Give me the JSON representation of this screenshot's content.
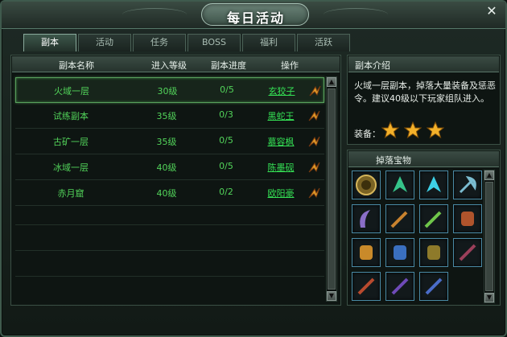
{
  "window": {
    "title": "每日活动"
  },
  "tabs": [
    {
      "label": "副本",
      "active": true
    },
    {
      "label": "活动",
      "active": false
    },
    {
      "label": "任务",
      "active": false
    },
    {
      "label": "BOSS",
      "active": false
    },
    {
      "label": "福利",
      "active": false
    },
    {
      "label": "活跃",
      "active": false
    }
  ],
  "table": {
    "headers": [
      "副本名称",
      "进入等级",
      "副本进度",
      "操作"
    ],
    "rows": [
      {
        "name": "火域一层",
        "level": "30级",
        "progress": "0/5",
        "npc": "玄狡子",
        "selected": true
      },
      {
        "name": "试练副本",
        "level": "35级",
        "progress": "0/3",
        "npc": "黑蛇王",
        "selected": false
      },
      {
        "name": "古矿一层",
        "level": "35级",
        "progress": "0/5",
        "npc": "慕容枫",
        "selected": false
      },
      {
        "name": "冰域一层",
        "level": "40级",
        "progress": "0/5",
        "npc": "陈墨砚",
        "selected": false
      },
      {
        "name": "赤月窟",
        "level": "40级",
        "progress": "0/2",
        "npc": "欧阳豪",
        "selected": false
      }
    ]
  },
  "intro": {
    "title": "副本介绍",
    "text": "火域一层副本，掉落大量装备及惩恶令。建议40级以下玩家组队进入。",
    "equip_label": "装备：",
    "stars": 3
  },
  "drops": {
    "title": "掉落宝物",
    "count": 15
  },
  "colors": {
    "green_text": "#52d45a",
    "link_green": "#35e255",
    "panel_bg": "#0e1512"
  }
}
